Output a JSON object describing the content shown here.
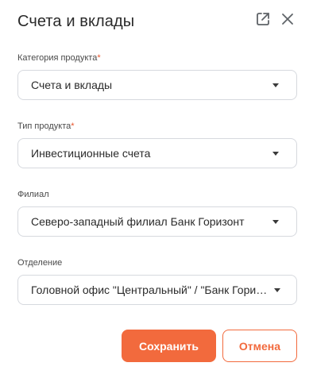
{
  "dialog": {
    "title": "Счета и вклады",
    "icons": {
      "open_external": "open-external-icon",
      "close": "close-icon"
    }
  },
  "fields": [
    {
      "label": "Категория продукта",
      "required": true,
      "required_mark": "*",
      "value": "Счета и вклады"
    },
    {
      "label": "Тип продукта",
      "required": true,
      "required_mark": "*",
      "value": "Инвестиционные счета"
    },
    {
      "label": "Филиал",
      "required": false,
      "value": "Северо-западный филиал Банк Горизонт"
    },
    {
      "label": "Отделение",
      "required": false,
      "value": "Головной офис \"Центральный\" / \"Банк Гориз..."
    }
  ],
  "actions": {
    "save_label": "Сохранить",
    "cancel_label": "Отмена"
  },
  "colors": {
    "accent": "#f26a3d",
    "required_mark": "#e8542b",
    "border": "#d6d9de",
    "text": "#2b2b2b"
  }
}
